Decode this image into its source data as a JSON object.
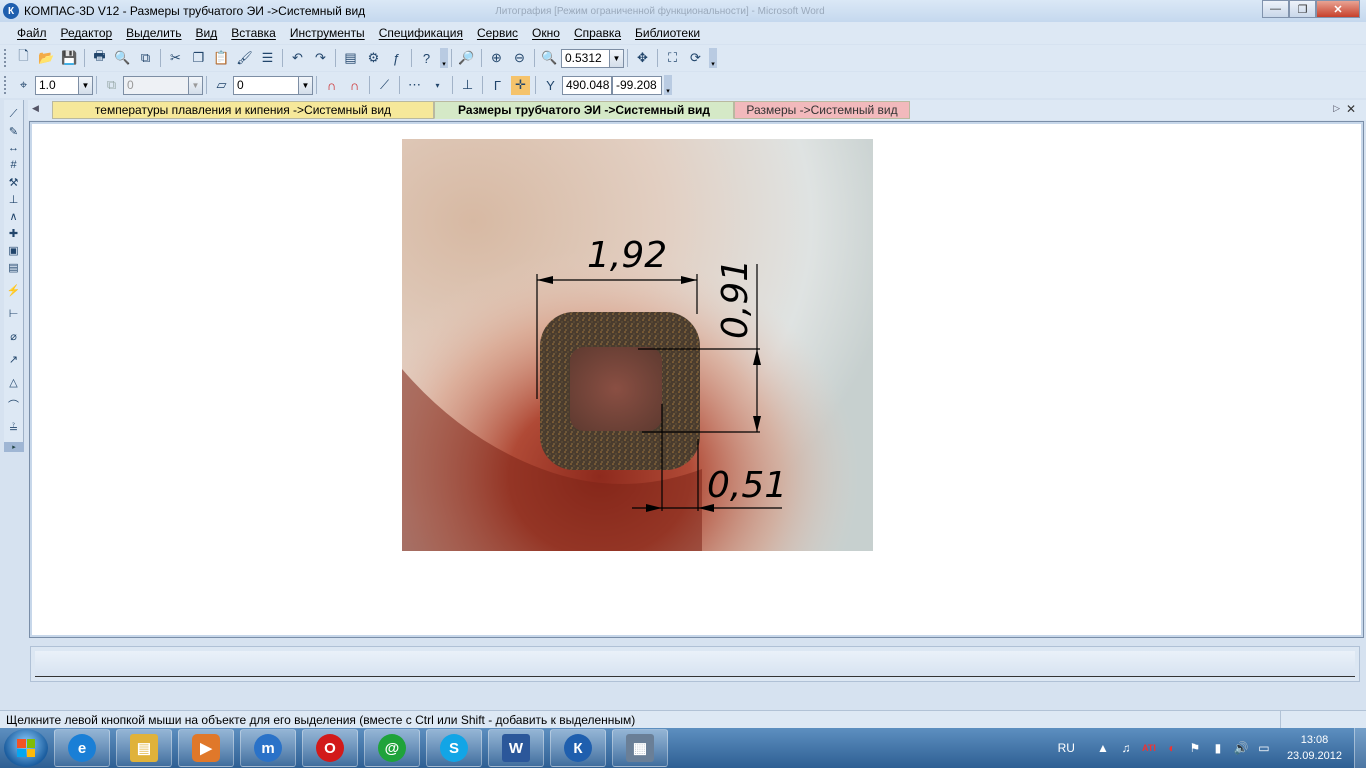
{
  "window": {
    "title": "КОМПАС-3D V12 - Размеры трубчатого ЭИ ->Системный вид",
    "faded_title": "Литография [Режим ограниченной функциональности] - Microsoft Word",
    "logo_letter": "К",
    "minimize_label": "—",
    "maximize_label": "❐",
    "close_label": "✕"
  },
  "menu": [
    "Файл",
    "Редактор",
    "Выделить",
    "Вид",
    "Вставка",
    "Инструменты",
    "Спецификация",
    "Сервис",
    "Окно",
    "Справка",
    "Библиотеки"
  ],
  "toolbar1": {
    "zoom_value": "0.5312"
  },
  "toolbar2": {
    "line_scale": "1.0",
    "layer_disabled": "0",
    "style_value": "0",
    "coord_x": "490.048",
    "coord_y": "-99.208"
  },
  "tabs": [
    {
      "label": "температуры плавления и кипения ->Системный вид",
      "color": "#f6e89a"
    },
    {
      "label": "Размеры трубчатого ЭИ ->Системный вид",
      "color": "#d5e9c7",
      "active": true
    },
    {
      "label": "Размеры ->Системный вид",
      "color": "#f2b9bc"
    }
  ],
  "drawing": {
    "dim_width": "1,92",
    "dim_height": "0,91",
    "dim_wall": "0,51"
  },
  "status": {
    "text": "Щелкните левой кнопкой мыши на объекте для его выделения (вместе с Ctrl или Shift - добавить к выделенным)"
  },
  "taskbar": {
    "apps": [
      {
        "name": "ie",
        "color": "#1a7fd6",
        "glyph": "e"
      },
      {
        "name": "explorer",
        "color": "#e0b23a",
        "glyph": "▤"
      },
      {
        "name": "media-player",
        "color": "#e0782a",
        "glyph": "▶"
      },
      {
        "name": "maxthon",
        "color": "#2a72c8",
        "glyph": "m"
      },
      {
        "name": "opera",
        "color": "#d21a1a",
        "glyph": "O"
      },
      {
        "name": "mail-agent",
        "color": "#1fa33a",
        "glyph": "@"
      },
      {
        "name": "skype",
        "color": "#12a5e6",
        "glyph": "S"
      },
      {
        "name": "word",
        "color": "#2b579a",
        "glyph": "W"
      },
      {
        "name": "kompas",
        "color": "#1f5fae",
        "glyph": "К"
      },
      {
        "name": "calculator",
        "color": "#6a7f97",
        "glyph": "▦"
      }
    ],
    "language": "RU",
    "time": "13:08",
    "date": "23.09.2012"
  }
}
